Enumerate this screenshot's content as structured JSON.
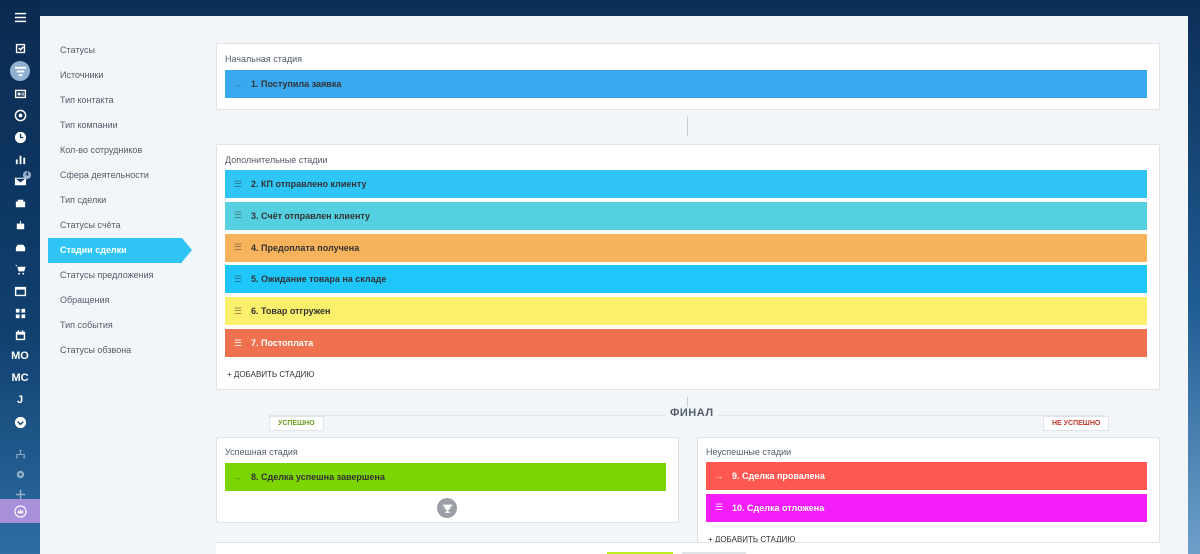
{
  "rail": {
    "badge_count": "4",
    "text_items": [
      "МО",
      "МС",
      "J"
    ]
  },
  "submenu": {
    "items": [
      {
        "label": "Статусы"
      },
      {
        "label": "Источники"
      },
      {
        "label": "Тип контакта"
      },
      {
        "label": "Тип компании"
      },
      {
        "label": "Кол-во сотрудников"
      },
      {
        "label": "Сфера деятельности"
      },
      {
        "label": "Тип сделки"
      },
      {
        "label": "Статусы счёта"
      },
      {
        "label": "Стадии сделки",
        "active": true
      },
      {
        "label": "Статусы предложения"
      },
      {
        "label": "Обращения"
      },
      {
        "label": "Тип события"
      },
      {
        "label": "Статусы обзвона"
      }
    ]
  },
  "initial": {
    "title": "Начальная стадия",
    "stage": {
      "label": "1. Поступила заявка",
      "color": "#39a8ef",
      "icon": "arrow-icon"
    }
  },
  "additional": {
    "title": "Дополнительные стадии",
    "stages": [
      {
        "label": "2. КП отправлено клиенту",
        "color": "#2fc6f6",
        "icon": "drag-handle-icon"
      },
      {
        "label": "3. Счёт отправлен клиенту",
        "color": "#55d0e0",
        "icon": "drag-handle-icon"
      },
      {
        "label": "4. Предоплата получена",
        "color": "#f7b35c",
        "icon": "drag-handle-icon"
      },
      {
        "label": "5. Ожидание товара на складе",
        "color": "#1ec6fa",
        "icon": "drag-handle-icon"
      },
      {
        "label": "6. Товар отгружен",
        "color": "#fbf06c",
        "icon": "drag-handle-icon"
      },
      {
        "label": "7. Постоплата",
        "color": "#f0714f",
        "icon": "drag-handle-icon",
        "light": true
      }
    ],
    "add_label": "+ ДОБАВИТЬ СТАДИЮ"
  },
  "final": {
    "title": "ФИНАЛ",
    "success_pill": "УСПЕШНО",
    "fail_pill": "НЕ УСПЕШНО",
    "success_color": "#6a9d1f",
    "fail_color": "#c0392b"
  },
  "success": {
    "title": "Успешная стадия",
    "stage": {
      "label": "8. Сделка успешна завершена",
      "color": "#7bd500",
      "icon": "arrow-icon"
    }
  },
  "failed": {
    "title": "Неуспешные стадии",
    "stages": [
      {
        "label": "9. Сделка провалена",
        "color": "#ff5752",
        "icon": "arrow-icon"
      },
      {
        "label": "10. Сделка отложена",
        "color": "#f31ef7",
        "icon": "drag-handle-icon"
      }
    ],
    "add_label": "+ ДОБАВИТЬ СТАДИЮ"
  },
  "footer": {
    "save_color": "#bbed21",
    "cancel_color": "#dfe3e7"
  }
}
